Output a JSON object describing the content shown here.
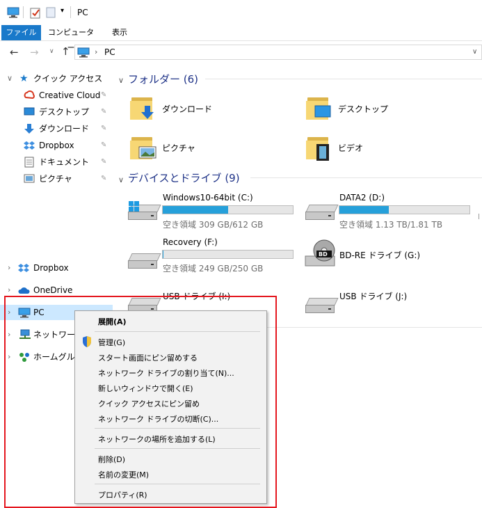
{
  "window": {
    "title": "PC"
  },
  "ribbon": {
    "tabs": [
      "ファイル",
      "コンピューター",
      "表示"
    ],
    "active_tab": "ファイル"
  },
  "address": {
    "path": "PC"
  },
  "nav": {
    "quick_access": "クイック アクセス",
    "pinned": [
      {
        "label": "Creative Cloud",
        "icon": "creative-cloud-icon"
      },
      {
        "label": "デスクトップ",
        "icon": "desktop-icon"
      },
      {
        "label": "ダウンロード",
        "icon": "download-icon"
      },
      {
        "label": "Dropbox",
        "icon": "dropbox-icon"
      },
      {
        "label": "ドキュメント",
        "icon": "document-icon"
      },
      {
        "label": "ピクチャ",
        "icon": "picture-icon"
      }
    ],
    "roots": [
      {
        "label": "Dropbox",
        "icon": "dropbox-icon"
      },
      {
        "label": "OneDrive",
        "icon": "onedrive-icon"
      },
      {
        "label": "PC",
        "icon": "pc-icon"
      },
      {
        "label": "ネットワーク",
        "icon": "network-icon"
      },
      {
        "label": "ホームグループ",
        "icon": "homegroup-icon"
      }
    ]
  },
  "folders": {
    "header": "フォルダー (6)",
    "items": [
      "ダウンロード",
      "デスクトップ",
      "ピクチャ",
      "ビデオ"
    ]
  },
  "devices": {
    "header": "デバイスとドライブ (9)",
    "drives": [
      {
        "name": "Windows10-64bit (C:)",
        "free": "空き領域 309 GB/612 GB",
        "used_fraction": 0.5
      },
      {
        "name": "DATA2 (D:)",
        "free": "空き領域 1.13 TB/1.81 TB",
        "used_fraction": 0.38
      },
      {
        "name": "Recovery (F:)",
        "free": "空き領域 249 GB/250 GB",
        "used_fraction": 0.004
      },
      {
        "name": "BD-RE ドライブ (G:)",
        "free": "",
        "used_fraction": null
      },
      {
        "name": "USB ドライブ (I:)",
        "free": "",
        "used_fraction": null
      },
      {
        "name": "USB ドライブ (J:)",
        "free": "",
        "used_fraction": null
      }
    ]
  },
  "context_menu": {
    "items": [
      {
        "label": "展開(A)",
        "bold": true
      },
      {
        "label": "管理(G)",
        "icon": "shield-icon"
      },
      {
        "label": "スタート画面にピン留めする"
      },
      {
        "label": "ネットワーク ドライブの割り当て(N)..."
      },
      {
        "label": "新しいウィンドウで開く(E)"
      },
      {
        "label": "クイック アクセスにピン留め"
      },
      {
        "label": "ネットワーク ドライブの切断(C)..."
      },
      {
        "label": "ネットワークの場所を追加する(L)"
      },
      {
        "label": "削除(D)"
      },
      {
        "label": "名前の変更(M)"
      },
      {
        "label": "プロパティ(R)"
      }
    ]
  },
  "colors": {
    "accent": "#1979ca",
    "highlight_box": "#e4161e",
    "bar_fill": "#26a0da",
    "group_header": "#1e3287"
  }
}
